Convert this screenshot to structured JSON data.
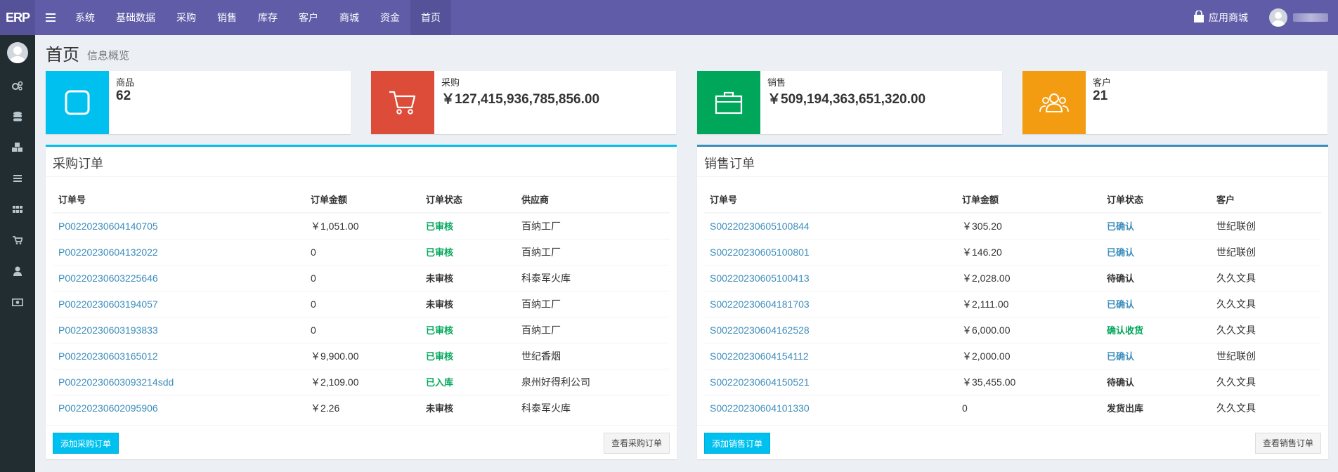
{
  "topbar": {
    "logo_first": "E",
    "logo_rest": "RP",
    "menu_toggle_icon": "hamburger-icon",
    "menu": [
      "系统",
      "基础数据",
      "采购",
      "销售",
      "库存",
      "客户",
      "商城",
      "资金",
      "首页"
    ],
    "active_menu": "首页",
    "app_store_label": "应用商城",
    "app_store_icon": "shopping-bag-icon",
    "bg_color": "#605ca8"
  },
  "sidebar": {
    "icons": [
      "cogs-icon",
      "database-icon",
      "cubes-icon",
      "list-icon",
      "grid-icon",
      "cart-icon",
      "user-icon",
      "money-icon"
    ],
    "bg_color": "#222d32"
  },
  "header": {
    "title": "首页",
    "subtitle": "信息概览"
  },
  "info_boxes": [
    {
      "label": "商品",
      "value": "62",
      "color": "#00c0ef",
      "icon": "square-icon"
    },
    {
      "label": "采购",
      "value": "￥127,415,936,785,856.00",
      "color": "#dd4b39",
      "icon": "cart-icon"
    },
    {
      "label": "销售",
      "value": "￥509,194,363,651,320.00",
      "color": "#00a65a",
      "icon": "briefcase-icon"
    },
    {
      "label": "客户",
      "value": "21",
      "color": "#f39c12",
      "icon": "users-icon"
    }
  ],
  "purchase": {
    "title": "采购订单",
    "columns": [
      "订单号",
      "订单金额",
      "订单状态",
      "供应商"
    ],
    "rows": [
      {
        "id": "P00220230604140705",
        "amount": "￥1,051.00",
        "status": "已审核",
        "party": "百纳工厂"
      },
      {
        "id": "P00220230604132022",
        "amount": "0",
        "status": "已审核",
        "party": "百纳工厂"
      },
      {
        "id": "P00220230603225646",
        "amount": "0",
        "status": "未审核",
        "party": "科泰军火库"
      },
      {
        "id": "P00220230603194057",
        "amount": "0",
        "status": "未审核",
        "party": "百纳工厂"
      },
      {
        "id": "P00220230603193833",
        "amount": "0",
        "status": "已审核",
        "party": "百纳工厂"
      },
      {
        "id": "P00220230603165012",
        "amount": "￥9,900.00",
        "status": "已审核",
        "party": "世纪香烟"
      },
      {
        "id": "P00220230603093214sdd",
        "amount": "￥2,109.00",
        "status": "已入库",
        "party": "泉州好得利公司"
      },
      {
        "id": "P00220230602095906",
        "amount": "￥2.26",
        "status": "未审核",
        "party": "科泰军火库"
      }
    ],
    "add_button": "添加采购订单",
    "view_button": "查看采购订单"
  },
  "sales": {
    "title": "销售订单",
    "columns": [
      "订单号",
      "订单金额",
      "订单状态",
      "客户"
    ],
    "rows": [
      {
        "id": "S00220230605100844",
        "amount": "￥305.20",
        "status": "已确认",
        "party": "世纪联创"
      },
      {
        "id": "S00220230605100801",
        "amount": "￥146.20",
        "status": "已确认",
        "party": "世纪联创"
      },
      {
        "id": "S00220230605100413",
        "amount": "￥2,028.00",
        "status": "待确认",
        "party": "久久文具"
      },
      {
        "id": "S00220230604181703",
        "amount": "￥2,111.00",
        "status": "已确认",
        "party": "久久文具"
      },
      {
        "id": "S00220230604162528",
        "amount": "￥6,000.00",
        "status": "确认收货",
        "party": "久久文具"
      },
      {
        "id": "S00220230604154112",
        "amount": "￥2,000.00",
        "status": "已确认",
        "party": "世纪联创"
      },
      {
        "id": "S00220230604150521",
        "amount": "￥35,455.00",
        "status": "待确认",
        "party": "久久文具"
      },
      {
        "id": "S00220230604101330",
        "amount": "0",
        "status": "发货出库",
        "party": "久久文具"
      }
    ],
    "add_button": "添加销售订单",
    "view_button": "查看销售订单"
  },
  "status_colors": {
    "已审核": "#00a65a",
    "已入库": "#00a65a",
    "确认收货": "#00a65a",
    "已确认": "#3c8dbc",
    "未审核": "#333333",
    "待确认": "#333333",
    "发货出库": "#333333"
  }
}
